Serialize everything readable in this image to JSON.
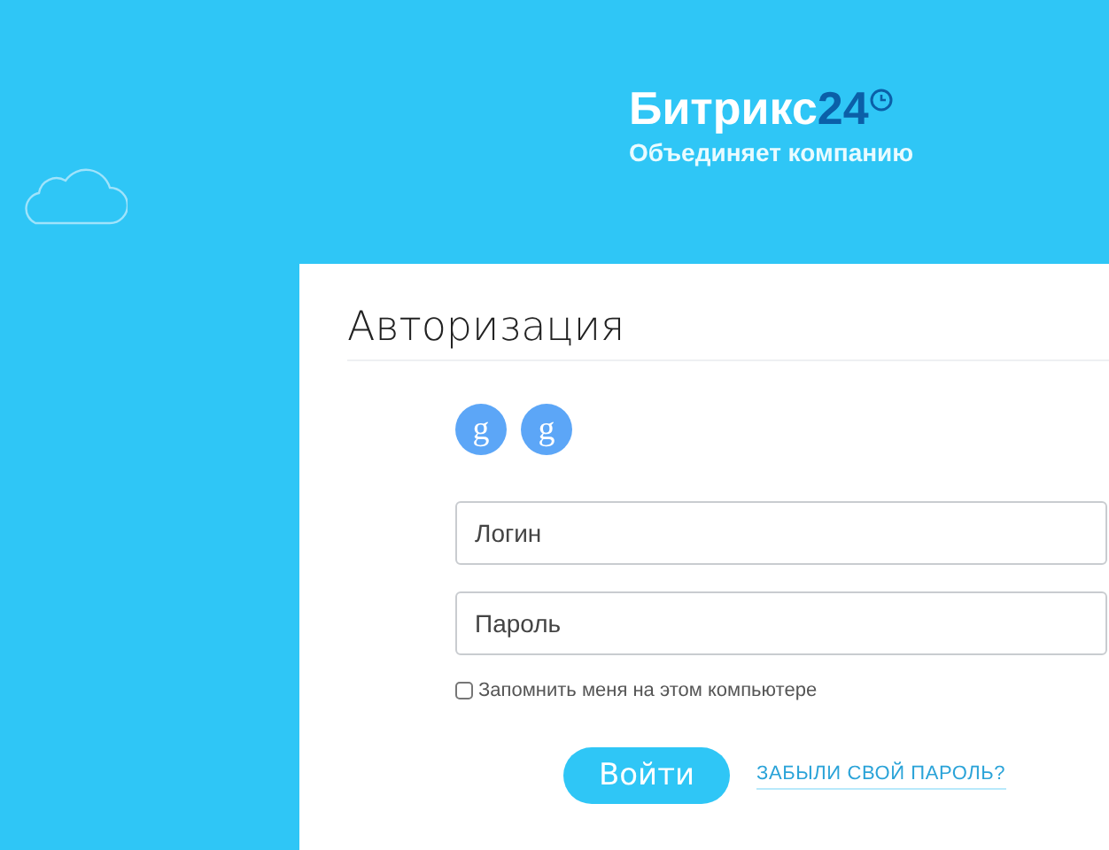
{
  "logo": {
    "name": "Битрикс",
    "number": "24",
    "tagline": "Объединяет компанию"
  },
  "card": {
    "title": "Авторизация",
    "social": [
      {
        "label": "g"
      },
      {
        "label": "g"
      }
    ],
    "fields": [
      {
        "placeholder": "Логин"
      },
      {
        "placeholder": "Пароль"
      }
    ],
    "remember": {
      "label": "Запомнить меня на этом компьютере",
      "checked": false
    },
    "submit": "Войти",
    "forgot": "ЗАБЫЛИ СВОЙ ПАРОЛЬ?"
  }
}
